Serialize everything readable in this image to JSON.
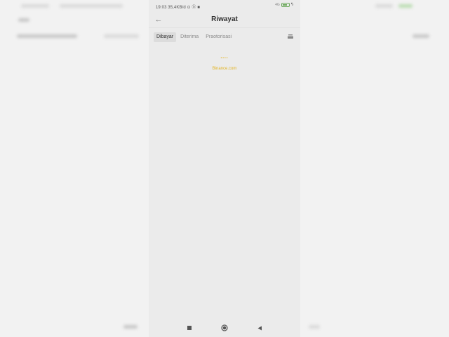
{
  "status_bar": {
    "left_text": "19:03  35,4KB/d ⊙ ⓑ ■",
    "signal_text": "4G",
    "battery_level": 0.55,
    "battery_color": "#6aa85a"
  },
  "header": {
    "title": "Riwayat",
    "back_icon": "back-arrow-icon"
  },
  "tabs": [
    {
      "label": "Dibayar",
      "active": true
    },
    {
      "label": "Diterima",
      "active": false
    },
    {
      "label": "Praotorisasi",
      "active": false
    }
  ],
  "filter_icon": "filter-icon",
  "loading": {
    "indicator": "••••",
    "brand_text": "Binance.com",
    "accent_color": "#e3b320"
  },
  "navbar": {
    "icons": [
      "square-recents-icon",
      "circle-home-icon",
      "triangle-back-icon"
    ]
  }
}
